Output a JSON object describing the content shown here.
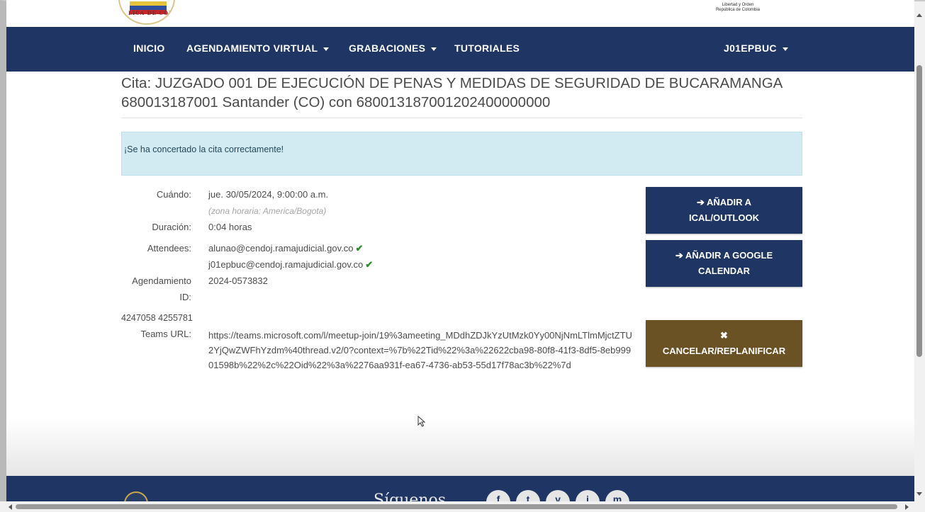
{
  "header": {
    "seal_text": "LICA DE COL",
    "coa_line1": "Libertad y Orden",
    "coa_line2": "República de Colombia"
  },
  "nav": {
    "items": [
      {
        "label": "INICIO"
      },
      {
        "label": "AGENDAMIENTO VIRTUAL"
      },
      {
        "label": "GRABACIONES"
      },
      {
        "label": "TUTORIALES"
      }
    ],
    "user": "J01EPBUC"
  },
  "page": {
    "title": "Cita: JUZGADO 001 DE EJECUCIÓN DE PENAS Y MEDIDAS DE SEGURIDAD DE BUCARAMANGA 680013187001 Santander (CO) con 680013187001202400000000",
    "alert": "¡Se ha concertado la cita correctamente!"
  },
  "details": {
    "when_label": "Cuándo:",
    "when_value": "jue. 30/05/2024, 9:00:00 a.m.",
    "timezone": "(zona horaria: America/Bogota)",
    "duration_label": "Duración:",
    "duration_value": "0:04 horas",
    "attendees_label": "Attendees:",
    "attendees": [
      "alunao@cendoj.ramajudicial.gov.co",
      "j01epbuc@cendoj.ramajudicial.gov.co"
    ],
    "scheduling_label_1": "Agendamiento",
    "scheduling_label_2": "ID:",
    "scheduling_value": "2024-0573832",
    "extra_ids": "4247058 4255781",
    "teams_label": "Teams URL:",
    "teams_url": "https://teams.microsoft.com/l/meetup-join/19%3ameeting_MDdhZDJkYzUtMzk0Yy00NjNmLTlmMjctZTU2YjQwZWFhYzdm%40thread.v2/0?context=%7b%22Tid%22%3a%22622cba98-80f8-41f3-8df5-8eb99901598b%22%2c%22Oid%22%3a%2276aa931f-ea67-4736-ab53-55d17f78ac3b%22%7d"
  },
  "buttons": {
    "ical_line1": "➔ AÑADIR A",
    "ical_line2": "ICAL/OUTLOOK",
    "google_line1": "➔ AÑADIR A GOOGLE",
    "google_line2": "CALENDAR",
    "cancel_icon": "✖",
    "cancel_label": "CANCELAR/REPLANIFICAR"
  },
  "footer": {
    "follow_text": "Síguenos",
    "social_icons": [
      "f",
      "t",
      "y",
      "i",
      "m"
    ]
  },
  "colors": {
    "navy": "#1f3563",
    "brown": "#6a5225",
    "alert_bg": "#d2eaf1",
    "check_green": "#2e8b2e"
  }
}
